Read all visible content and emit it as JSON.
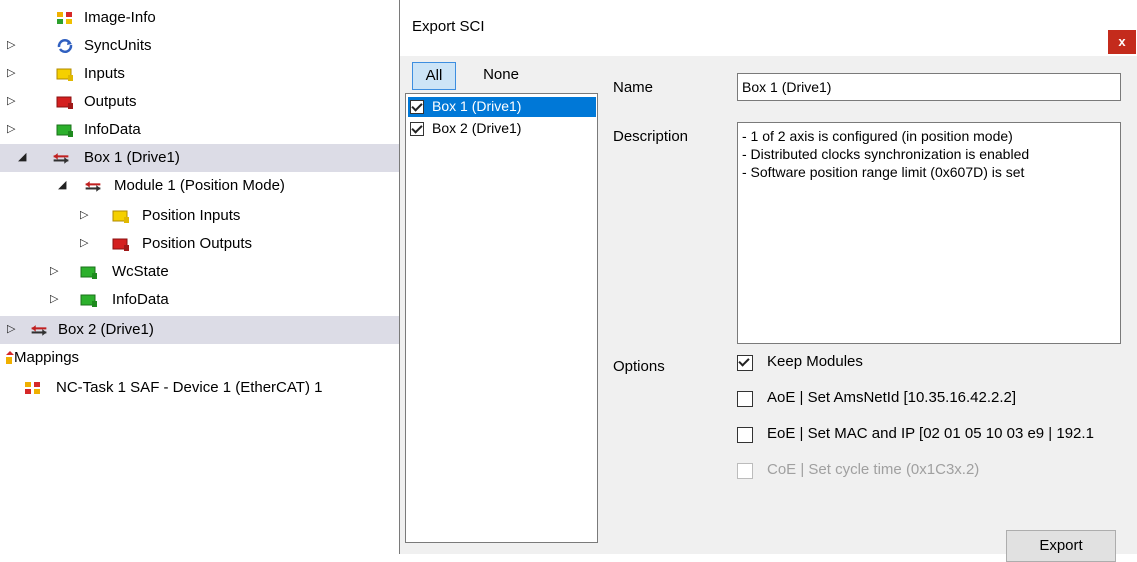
{
  "tree": {
    "items": [
      {
        "label": "Image-Info"
      },
      {
        "label": "SyncUnits"
      },
      {
        "label": "Inputs"
      },
      {
        "label": "Outputs"
      },
      {
        "label": "InfoData"
      },
      {
        "label": "Box 1 (Drive1)"
      },
      {
        "label": "Module 1 (Position Mode)"
      },
      {
        "label": "Position Inputs"
      },
      {
        "label": "Position Outputs"
      },
      {
        "label": "WcState"
      },
      {
        "label": "InfoData"
      },
      {
        "label": "Box 2 (Drive1)"
      },
      {
        "label": "Mappings"
      },
      {
        "label": "NC-Task 1 SAF - Device 1 (EtherCAT) 1"
      }
    ]
  },
  "dialog": {
    "title": "Export SCI",
    "close_label": "x",
    "all_label": "All",
    "none_label": "None",
    "list": [
      {
        "label": "Box 1 (Drive1)",
        "checked": true,
        "selected": true
      },
      {
        "label": "Box 2 (Drive1)",
        "checked": true,
        "selected": false
      }
    ],
    "name_label": "Name",
    "name_value": "Box 1 (Drive1)",
    "description_label": "Description",
    "description_lines": [
      "- 1 of 2 axis is configured (in position mode)",
      "- Distributed clocks synchronization is enabled",
      "- Software position range limit (0x607D) is set"
    ],
    "options_label": "Options",
    "options": [
      {
        "label": "Keep Modules",
        "checked": true,
        "enabled": true
      },
      {
        "label": "AoE | Set AmsNetId [10.35.16.42.2.2]",
        "checked": false,
        "enabled": true
      },
      {
        "label": "EoE | Set MAC and IP [02 01 05 10 03 e9 | 192.1",
        "checked": false,
        "enabled": true
      },
      {
        "label": "CoE | Set cycle time (0x1C3x.2)",
        "checked": false,
        "enabled": false
      }
    ],
    "export_label": "Export",
    "colors": {
      "selection": "#0078d7",
      "tree_selection": "#dcdce6",
      "close": "#c42b1c"
    }
  }
}
